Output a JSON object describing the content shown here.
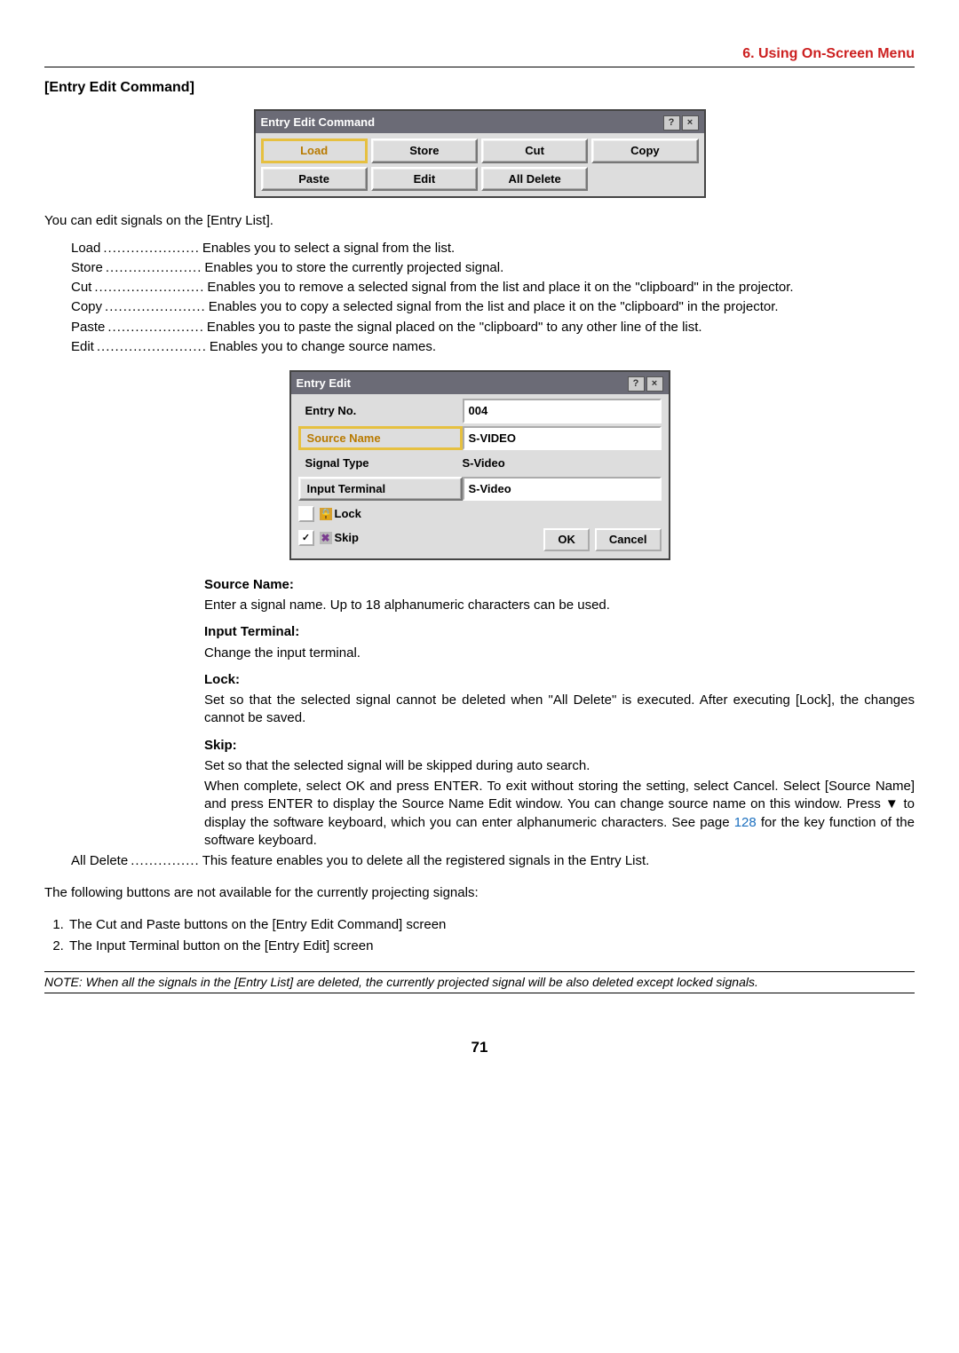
{
  "header": {
    "section": "6. Using On-Screen Menu"
  },
  "sub": {
    "title": "[Entry Edit Command]"
  },
  "dialog1": {
    "title": "Entry Edit Command",
    "buttons": {
      "load": "Load",
      "store": "Store",
      "cut": "Cut",
      "copy": "Copy",
      "paste": "Paste",
      "edit": "Edit",
      "all_delete": "All Delete"
    }
  },
  "intro": "You can edit signals on the [Entry List].",
  "defs": {
    "load": {
      "term": "Load",
      "dots": ".....................",
      "desc": "Enables you to select a signal from the list."
    },
    "store": {
      "term": "Store",
      "dots": ".....................",
      "desc": "Enables you to store the currently projected signal."
    },
    "cut": {
      "term": "Cut",
      "dots": "........................",
      "desc": "Enables you to remove a selected signal from the list and place it on the \"clipboard\" in the projector."
    },
    "copy": {
      "term": "Copy",
      "dots": "......................",
      "desc": "Enables you to copy a selected signal from the list and place it on the \"clipboard\" in the projector."
    },
    "paste": {
      "term": "Paste",
      "dots": ".....................",
      "desc": "Enables you to paste the signal placed on the \"clipboard\" to any other line of the list."
    },
    "edit": {
      "term": "Edit",
      "dots": "........................",
      "desc": "Enables you to change source names."
    }
  },
  "dialog2": {
    "title": "Entry Edit",
    "entry_no_label": "Entry No.",
    "entry_no_value": "004",
    "source_name_label": "Source Name",
    "source_name_value": "S-VIDEO",
    "signal_type_label": "Signal Type",
    "signal_type_value": "S-Video",
    "input_terminal_label": "Input Terminal",
    "input_terminal_value": "S-Video",
    "lock_label": "Lock",
    "skip_label": "Skip",
    "ok": "OK",
    "cancel": "Cancel"
  },
  "desc": {
    "source_name_h": "Source Name:",
    "source_name_t": "Enter a signal name. Up to 18 alphanumeric characters can be used.",
    "input_terminal_h": "Input Terminal:",
    "input_terminal_t": "Change the input terminal.",
    "lock_h": "Lock:",
    "lock_t": "Set so that the selected signal cannot be deleted when \"All Delete\" is executed. After executing [Lock], the changes cannot be saved.",
    "skip_h": "Skip:",
    "skip_t": "Set so that the selected signal will be skipped during auto search.",
    "complete_a": "When complete, select OK and press ENTER. To exit without storing the setting, select Cancel. Select [Source Name] and press ENTER to display the Source Name Edit window. You can change source name on this window. Press ▼ to display the software keyboard, which you can enter alphanumeric characters. See page ",
    "link": "128",
    "complete_b": " for the key function of the software keyboard."
  },
  "all_delete": {
    "term": "All Delete",
    "dots": "...............",
    "desc": "This feature enables you to delete all the registered signals in the Entry List."
  },
  "not_avail": "The following buttons are not available for the currently projecting signals:",
  "list": {
    "i1": "The Cut and Paste buttons on the [Entry Edit Command] screen",
    "i2": "The Input Terminal button on the [Entry Edit] screen"
  },
  "note": "NOTE: When all the signals in the [Entry List] are deleted, the currently projected signal will be also deleted except locked signals.",
  "page": "71"
}
